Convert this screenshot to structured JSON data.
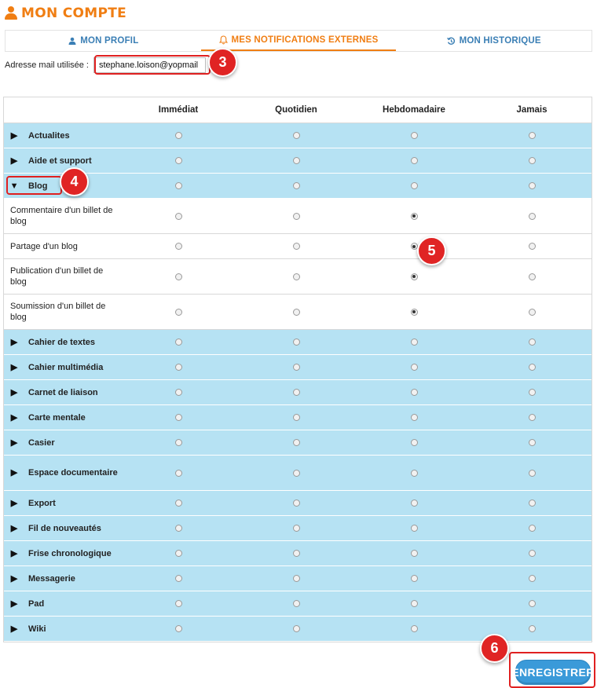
{
  "header": {
    "title": "MON COMPTE",
    "icon": "user-icon",
    "accent": "#f07e13"
  },
  "tabs": [
    {
      "label": "MON PROFIL",
      "icon": "user-icon",
      "active": false
    },
    {
      "label": "MES NOTIFICATIONS EXTERNES",
      "icon": "bell-icon",
      "active": true
    },
    {
      "label": "MON HISTORIQUE",
      "icon": "history-icon",
      "active": false
    }
  ],
  "email": {
    "label": "Adresse mail utilisée :",
    "value": "stephane.loison@yopmail"
  },
  "columns": [
    "Immédiat",
    "Quotidien",
    "Hebdomadaire",
    "Jamais"
  ],
  "rows": [
    {
      "label": "Actualites",
      "type": "category",
      "expanded": false,
      "selected": null
    },
    {
      "label": "Aide et support",
      "type": "category",
      "expanded": false,
      "selected": null
    },
    {
      "label": "Blog",
      "type": "category",
      "expanded": true,
      "selected": null
    },
    {
      "label": "Commentaire d'un billet de blog",
      "type": "sub",
      "selected": 2
    },
    {
      "label": "Partage d'un blog",
      "type": "sub",
      "selected": 2
    },
    {
      "label": "Publication d'un billet de blog",
      "type": "sub",
      "selected": 2
    },
    {
      "label": "Soumission d'un billet de blog",
      "type": "sub",
      "selected": 2
    },
    {
      "label": "Cahier de textes",
      "type": "category",
      "expanded": false,
      "selected": null
    },
    {
      "label": "Cahier multimédia",
      "type": "category",
      "expanded": false,
      "selected": null
    },
    {
      "label": "Carnet de liaison",
      "type": "category",
      "expanded": false,
      "selected": null
    },
    {
      "label": "Carte mentale",
      "type": "category",
      "expanded": false,
      "selected": null
    },
    {
      "label": "Casier",
      "type": "category",
      "expanded": false,
      "selected": null
    },
    {
      "label": "Espace documentaire",
      "type": "category",
      "expanded": false,
      "selected": null
    },
    {
      "label": "Export",
      "type": "category",
      "expanded": false,
      "selected": null
    },
    {
      "label": "Fil de nouveautés",
      "type": "category",
      "expanded": false,
      "selected": null
    },
    {
      "label": "Frise chronologique",
      "type": "category",
      "expanded": false,
      "selected": null
    },
    {
      "label": "Messagerie",
      "type": "category",
      "expanded": false,
      "selected": null
    },
    {
      "label": "Pad",
      "type": "category",
      "expanded": false,
      "selected": null
    },
    {
      "label": "Wiki",
      "type": "category",
      "expanded": false,
      "selected": null
    }
  ],
  "save_label": "ENREGISTRER",
  "annotations": {
    "email": "3",
    "blog": "4",
    "partage": "5",
    "save": "6"
  },
  "colors": {
    "category_bg": "#b6e2f3",
    "tab_blue": "#3b7fb5",
    "button_blue": "#3a9ad9",
    "annotation_red": "#e02424"
  }
}
